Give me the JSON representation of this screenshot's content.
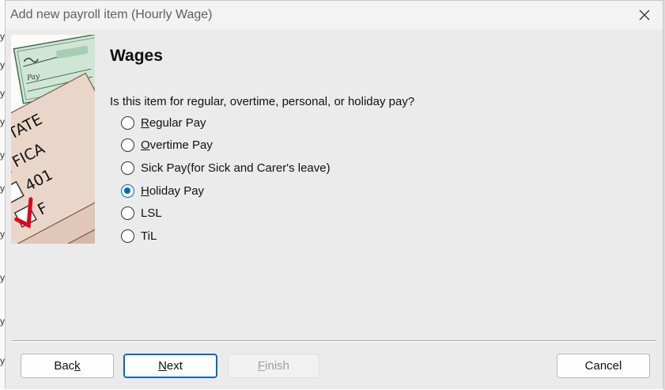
{
  "dialog": {
    "title": "Add new payroll item (Hourly Wage)",
    "close_icon": "close-icon",
    "heading": "Wages",
    "question": "Is this item for regular, overtime, personal, or holiday pay?",
    "options": [
      {
        "mnemonic": "R",
        "rest": "egular Pay",
        "checked": false
      },
      {
        "mnemonic": "O",
        "rest": "vertime Pay",
        "checked": false
      },
      {
        "mnemonic": "",
        "rest": "Sick Pay(for Sick and Carer's leave)",
        "checked": false
      },
      {
        "mnemonic": "H",
        "rest": "oliday Pay",
        "checked": true
      },
      {
        "mnemonic": "",
        "rest": "LSL",
        "checked": false
      },
      {
        "mnemonic": "",
        "rest": "TiL",
        "checked": false
      }
    ],
    "illustration": {
      "labels": [
        "STATE",
        "FICA",
        "401",
        "F"
      ],
      "check_text": "Pay",
      "icon": "payroll-forms-illustration"
    },
    "buttons": {
      "back_pre": "Bac",
      "back_mn": "k",
      "back_post": "",
      "next_pre": "",
      "next_mn": "N",
      "next_post": "ext",
      "finish_pre": "",
      "finish_mn": "F",
      "finish_post": "inish",
      "cancel": "Cancel"
    }
  },
  "colors": {
    "accent": "#0067c0",
    "check_red": "#e0001b",
    "dialog_bg": "#ebebeb"
  }
}
